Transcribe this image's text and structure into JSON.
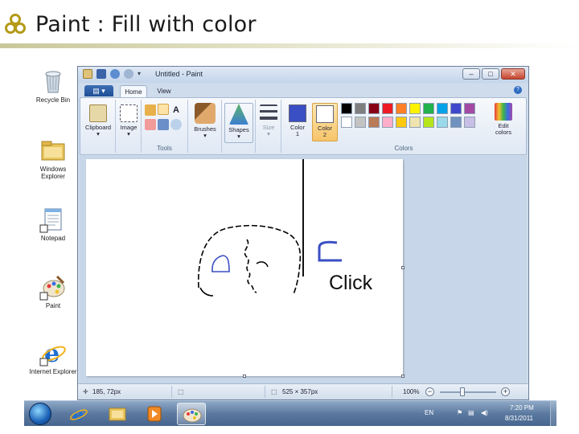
{
  "slide": {
    "title": "Paint : Fill with color"
  },
  "desktop_icons": [
    {
      "label": "Recycle Bin",
      "icon": "recycle-bin-icon"
    },
    {
      "label": "Windows Explorer",
      "icon": "folder-icon"
    },
    {
      "label": "Notepad",
      "icon": "notepad-icon"
    },
    {
      "label": "Paint",
      "icon": "paint-palette-icon"
    },
    {
      "label": "Internet Explorer",
      "icon": "internet-explorer-icon"
    }
  ],
  "window": {
    "title": "Untitled - Paint",
    "tabs": [
      "Home",
      "View"
    ]
  },
  "ribbon": {
    "clipboard_label": "Clipboard",
    "image_label": "Image",
    "tools_group": "Tools",
    "brushes_label": "Brushes",
    "shapes_label": "Shapes",
    "size_label": "Size",
    "color1_label": "Color",
    "color1_num": "1",
    "color2_label": "Color",
    "color2_num": "2",
    "edit_colors_line1": "Edit",
    "edit_colors_line2": "colors",
    "colors_group": "Colors",
    "color1_value": "#3a4fc4",
    "color2_value": "#ffffff",
    "palette_row1": [
      "#000000",
      "#7f7f7f",
      "#880015",
      "#ed1c24",
      "#ff7f27",
      "#fff200",
      "#22b14c",
      "#00a2e8",
      "#3f48cc",
      "#a349a4"
    ],
    "palette_row2": [
      "#ffffff",
      "#c3c3c3",
      "#b97a57",
      "#ffaec9",
      "#ffc90e",
      "#efe4b0",
      "#b5e61d",
      "#99d9ea",
      "#7092be",
      "#c8bfe7"
    ]
  },
  "canvas": {
    "annotation": "Click"
  },
  "status": {
    "cursor_pos": "185, 72px",
    "canvas_size": "525 × 357px",
    "zoom": "100%"
  },
  "taskbar": {
    "language": "EN",
    "time": "7:20 PM",
    "date": "8/31/2011"
  }
}
